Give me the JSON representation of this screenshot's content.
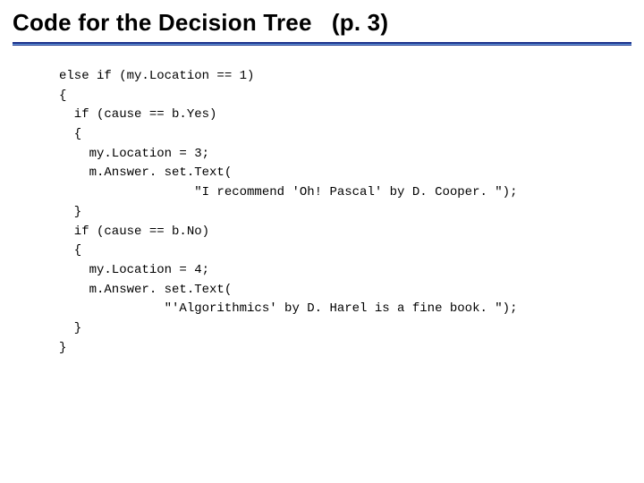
{
  "title": {
    "main": "Code for the Decision Tree",
    "page": "(p. 3)"
  },
  "code": [
    "else if (my.Location == 1)",
    "{",
    "  if (cause == b.Yes)",
    "  {",
    "    my.Location = 3;",
    "    m.Answer. set.Text(",
    "                  \"I recommend 'Oh! Pascal' by D. Cooper. \");",
    "  }",
    "  if (cause == b.No)",
    "  {",
    "    my.Location = 4;",
    "    m.Answer. set.Text(",
    "              \"'Algorithmics' by D. Harel is a fine book. \");",
    "  }",
    "}"
  ]
}
